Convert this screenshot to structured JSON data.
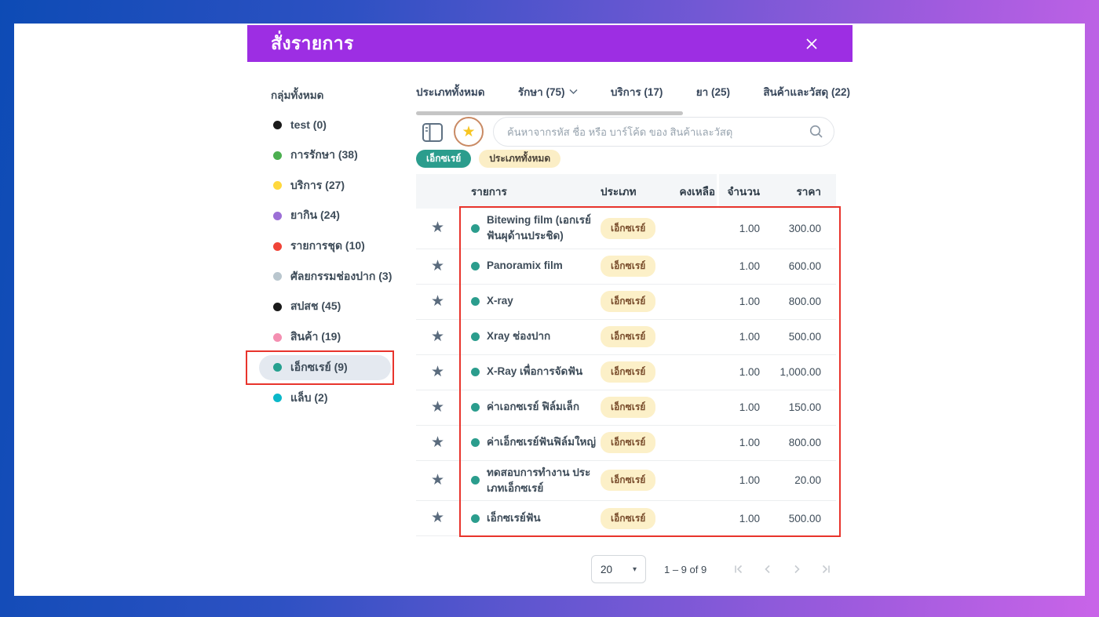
{
  "modal": {
    "title": "สั่งรายการ"
  },
  "sidebar": {
    "header": "กลุ่มทั้งหมด",
    "items": [
      {
        "label": "test (0)",
        "color": "#1A1A1A",
        "selected": false
      },
      {
        "label": "การรักษา (38)",
        "color": "#4CAF50",
        "selected": false
      },
      {
        "label": "บริการ (27)",
        "color": "#FFD83D",
        "selected": false
      },
      {
        "label": "ยากิน (24)",
        "color": "#9C6FD6",
        "selected": false
      },
      {
        "label": "รายการชุด (10)",
        "color": "#F04438",
        "selected": false
      },
      {
        "label": "ศัลยกรรมช่องปาก (3)",
        "color": "#B9C6CE",
        "selected": false
      },
      {
        "label": "สปสช (45)",
        "color": "#1A1A1A",
        "selected": false
      },
      {
        "label": "สินค้า (19)",
        "color": "#F48FB1",
        "selected": false
      },
      {
        "label": "เอ็กซเรย์ (9)",
        "color": "#26A08F",
        "selected": true
      },
      {
        "label": "แล็บ (2)",
        "color": "#0BB8C9",
        "selected": false
      }
    ]
  },
  "tabs": [
    {
      "label": "ประเภททั้งหมด",
      "has_dropdown": false
    },
    {
      "label": "รักษา (75)",
      "has_dropdown": true
    },
    {
      "label": "บริการ (17)",
      "has_dropdown": false
    },
    {
      "label": "ยา (25)",
      "has_dropdown": false
    },
    {
      "label": "สินค้าและวัสดุ (22)",
      "has_dropdown": false
    }
  ],
  "search": {
    "placeholder": "ค้นหาจากรหัส ชื่อ หรือ บาร์โค้ด ของ สินค้าและวัสดุ"
  },
  "filters": [
    {
      "label": "เอ็กซเรย์",
      "style": "teal"
    },
    {
      "label": "ประเภททั้งหมด",
      "style": "cream"
    }
  ],
  "table": {
    "headers": {
      "item": "รายการ",
      "type": "ประเภท",
      "remaining": "คงเหลือ",
      "quantity": "จำนวน",
      "price": "ราคา"
    },
    "rows": [
      {
        "name": "Bitewing film (เอกเรย์ ฟันผุด้านประชิด)",
        "type": "เอ็กซเรย์",
        "remaining": "",
        "quantity": "1.00",
        "price": "300.00"
      },
      {
        "name": "Panoramix film",
        "type": "เอ็กซเรย์",
        "remaining": "",
        "quantity": "1.00",
        "price": "600.00"
      },
      {
        "name": "X-ray",
        "type": "เอ็กซเรย์",
        "remaining": "",
        "quantity": "1.00",
        "price": "800.00"
      },
      {
        "name": "Xray ช่องปาก",
        "type": "เอ็กซเรย์",
        "remaining": "",
        "quantity": "1.00",
        "price": "500.00"
      },
      {
        "name": "X-Ray เพื่อการจัดฟัน",
        "type": "เอ็กซเรย์",
        "remaining": "",
        "quantity": "1.00",
        "price": "1,000.00"
      },
      {
        "name": "ค่าเอกซเรย์ ฟิล์มเล็ก",
        "type": "เอ็กซเรย์",
        "remaining": "",
        "quantity": "1.00",
        "price": "150.00"
      },
      {
        "name": "ค่าเอ็กซเรย์ฟันฟิล์มใหญ่",
        "type": "เอ็กซเรย์",
        "remaining": "",
        "quantity": "1.00",
        "price": "800.00"
      },
      {
        "name": "ทดสอบการทำงาน ประเภทเอ็กซเรย์",
        "type": "เอ็กซเรย์",
        "remaining": "",
        "quantity": "1.00",
        "price": "20.00"
      },
      {
        "name": "เอ็กซเรย์ฟัน",
        "type": "เอ็กซเรย์",
        "remaining": "",
        "quantity": "1.00",
        "price": "500.00"
      }
    ]
  },
  "pagination": {
    "page_size": "20",
    "range_label": "1 – 9 of 9"
  },
  "icons": {
    "close": "x-cross",
    "panel": "sidebar-layout",
    "favorite": "star-in-circle",
    "search": "magnifier",
    "tab_caret": "chevron-down",
    "row_star": "star",
    "page_size_caret": "caret-down",
    "first_page": "bar-chevron-left",
    "prev_page": "chevron-left",
    "next_page": "chevron-right",
    "last_page": "chevron-right-bar"
  },
  "colors": {
    "frame-blue": "#0D4BB5",
    "frame-purple": "#C964E8",
    "header-purple": "#9D2EE3",
    "annotation-red": "#E8342C",
    "teal": "#2B9D8D",
    "badge-bg": "#FCF0C8",
    "badge-text": "#7A4E2D",
    "chip-cream-bg": "#FBEEC6",
    "star-gold": "#F7C521",
    "star-row": "#5A6B7D",
    "selected-pill": "#E4E9F0"
  }
}
